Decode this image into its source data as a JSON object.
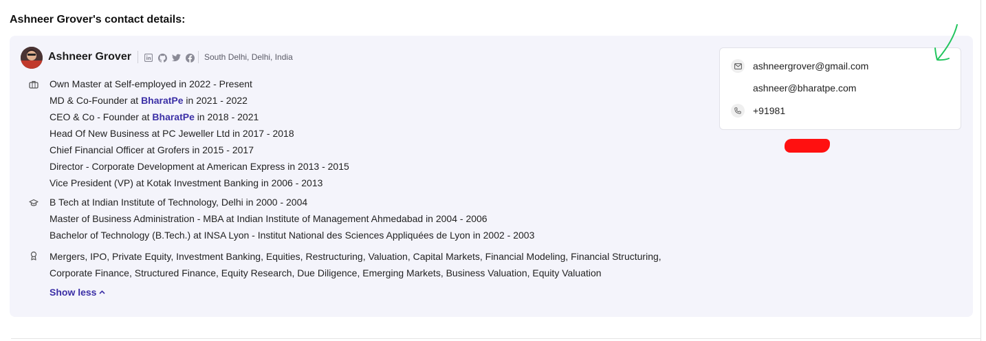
{
  "page": {
    "title": "Ashneer Grover's contact details:"
  },
  "profile": {
    "name": "Ashneer Grover",
    "location": "South Delhi, Delhi, India",
    "social_icons": [
      "linkedin-icon",
      "github-icon",
      "twitter-icon",
      "facebook-icon"
    ]
  },
  "experience": [
    {
      "pre": "Own Master at Self-employed in 2022 - Present",
      "company": "",
      "post": ""
    },
    {
      "pre": "MD & Co-Founder at ",
      "company": "BharatPe",
      "post": " in 2021 - 2022"
    },
    {
      "pre": "CEO & Co - Founder at ",
      "company": "BharatPe",
      "post": " in 2018 - 2021"
    },
    {
      "pre": "Head Of New Business at PC Jeweller Ltd in 2017 - 2018",
      "company": "",
      "post": ""
    },
    {
      "pre": "Chief Financial Officer at Grofers in 2015 - 2017",
      "company": "",
      "post": ""
    },
    {
      "pre": "Director - Corporate Development at American Express in 2013 - 2015",
      "company": "",
      "post": ""
    },
    {
      "pre": "Vice President (VP) at Kotak Investment Banking in 2006 - 2013",
      "company": "",
      "post": ""
    }
  ],
  "education": [
    "B Tech at Indian Institute of Technology, Delhi in 2000 - 2004",
    "Master of Business Administration - MBA at Indian Institute of Management Ahmedabad in 2004 - 2006",
    "Bachelor of Technology (B.Tech.) at INSA Lyon - Institut National des Sciences Appliquées de Lyon in 2002 - 2003"
  ],
  "skills": [
    "Mergers, IPO, Private Equity, Investment Banking, Equities, Restructuring, Valuation, Capital Markets, Financial Modeling, Financial Structuring,",
    "Corporate Finance, Structured Finance, Equity Research, Due Diligence, Emerging Markets, Business Valuation, Equity Valuation"
  ],
  "toggle": {
    "label": "Show less"
  },
  "contact": {
    "email_primary": "ashneergrover@gmail.com",
    "email_secondary": "ashneer@bharatpe.com",
    "phone": "+91981"
  },
  "colors": {
    "accent": "#3b2fa6",
    "card_bg": "#f4f4fb",
    "redaction": "#ff1010",
    "annotation": "#22c55e"
  }
}
